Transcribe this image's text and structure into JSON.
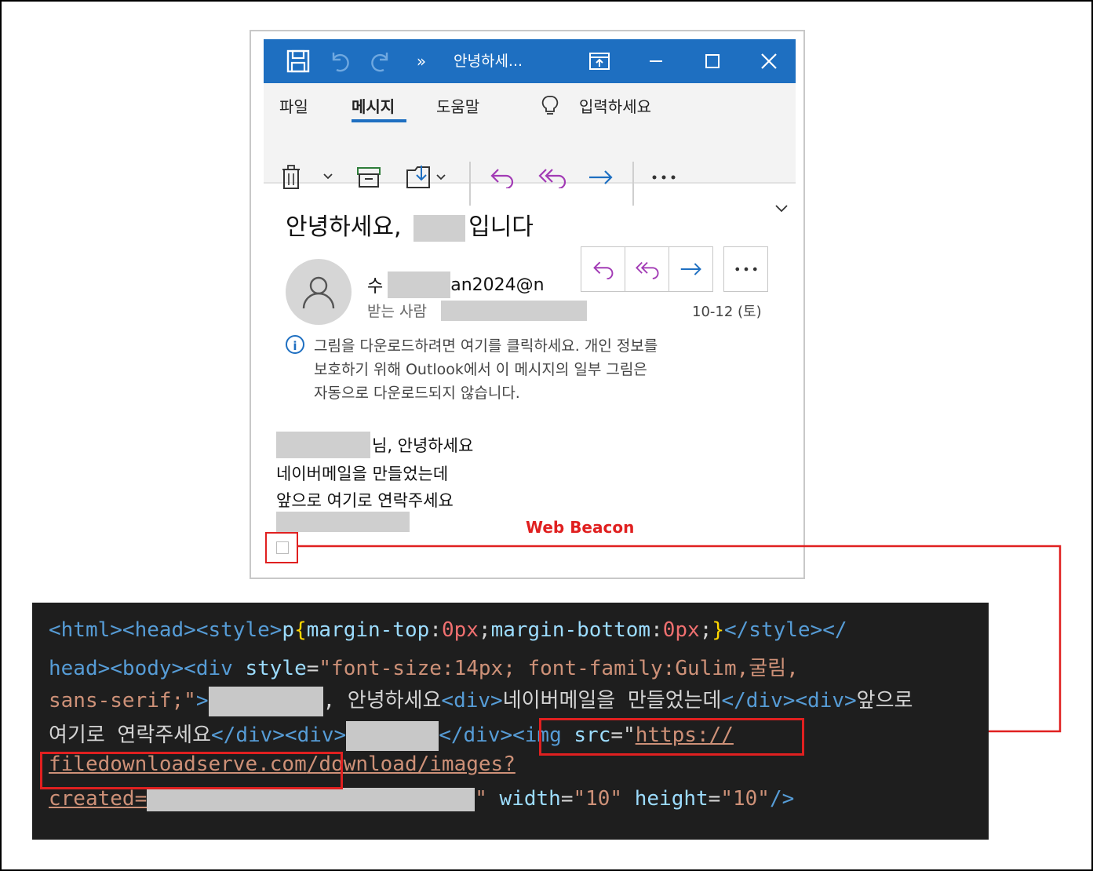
{
  "window": {
    "title": "안녕하세...",
    "overflow_chevrons": "»",
    "icons": [
      "save-icon",
      "undo-icon",
      "redo-icon",
      "popout-icon",
      "minimize-icon",
      "maximize-icon",
      "close-icon"
    ]
  },
  "ribbon": {
    "menus": [
      "파일",
      "메시지",
      "도움말"
    ],
    "active_menu": "메시지",
    "search_placeholder": "입력하세요",
    "actions": [
      "delete",
      "archive",
      "move",
      "reply",
      "reply-all",
      "forward",
      "more"
    ]
  },
  "email": {
    "subject_prefix": "안녕하세요,",
    "subject_suffix": "입니다",
    "sender_prefix": "수",
    "sender_suffix": "an2024@n",
    "to_label": "받는 사람",
    "date": "10-12 (토)",
    "info_lines": [
      "그림을 다운로드하려면 여기를 클릭하세요. 개인 정보를",
      "보호하기 위해 Outlook에서 이 메시지의 일부 그림은",
      "자동으로 다운로드되지 않습니다."
    ],
    "body_line1_suffix": "님, 안녕하세요",
    "body_line2": "네이버메일을 만들었는데",
    "body_line3": "앞으로 여기로 연락주세요"
  },
  "annotation": {
    "beacon_label": "Web Beacon",
    "accent": "#e02020"
  },
  "code": {
    "l1": {
      "a": "<html><head><style>",
      "b": "p",
      "c": "{",
      "d": "margin-top",
      "e": ":",
      "f": "0px",
      "g": ";",
      "h": "margin-bottom",
      "i": ":",
      "j": "0px",
      "k": ";",
      "l": "}",
      "m": "</style></"
    },
    "l2": {
      "a": "head><body><div ",
      "b": "style",
      "c": "=",
      "d": "\"font-size:14px; font-family:Gulim,굴림,",
      "e": ""
    },
    "l3": {
      "a": "sans-serif;\"",
      "b": ">",
      "c": ", 안녕하세요",
      "d": "<div>",
      "e": "네이버메일을 만들었는데",
      "f": "</div><div>",
      "g": "앞으로"
    },
    "l4": {
      "a": "여기로 연락주세요",
      "b": "</div><div>",
      "c": "</div>",
      "d": "<img ",
      "e": "src",
      "f": "=\"",
      "g": "https://"
    },
    "l5": {
      "a": "filedownloadserve.com",
      "b": "/download/images?"
    },
    "l6": {
      "a": "created=",
      "b": "\"",
      "c": " width",
      "d": "=",
      "e": "\"10\"",
      "f": " height",
      "g": "=",
      "h": "\"10\"",
      "i": "/>"
    }
  }
}
